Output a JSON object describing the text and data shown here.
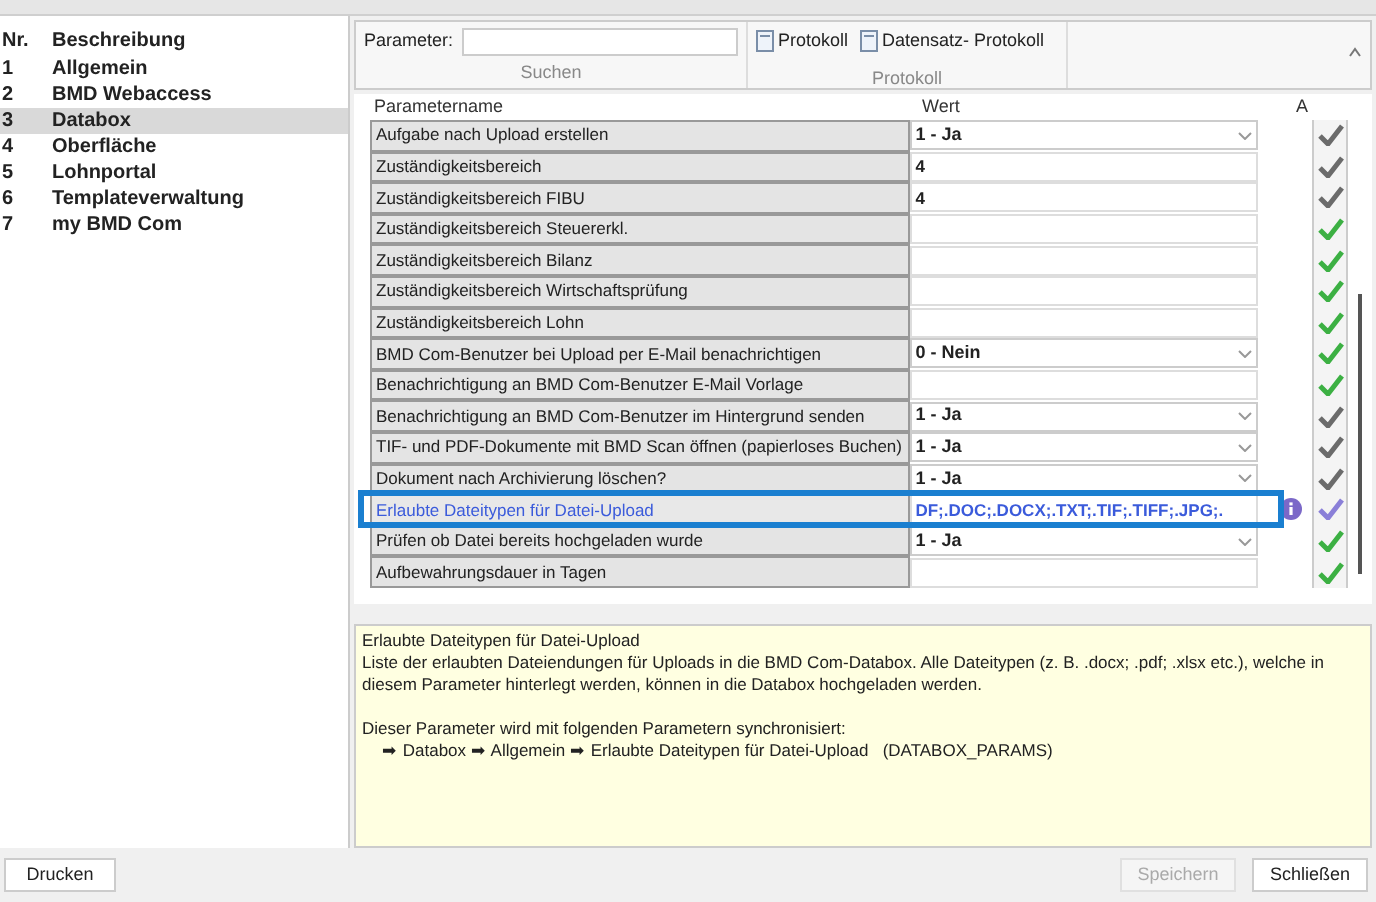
{
  "sidebar": {
    "columns": [
      "Nr.",
      "Beschreibung"
    ],
    "items": [
      {
        "nr": "1",
        "label": "Allgemein",
        "selected": false
      },
      {
        "nr": "2",
        "label": "BMD Webaccess",
        "selected": false
      },
      {
        "nr": "3",
        "label": "Databox",
        "selected": true
      },
      {
        "nr": "4",
        "label": "Oberfläche",
        "selected": false
      },
      {
        "nr": "5",
        "label": "Lohnportal",
        "selected": false
      },
      {
        "nr": "6",
        "label": "Templateverwaltung",
        "selected": false
      },
      {
        "nr": "7",
        "label": "my BMD Com",
        "selected": false
      }
    ]
  },
  "toolbar": {
    "search_label": "Parameter:",
    "search_group": "Suchen",
    "buttons": [
      "Protokoll",
      "Datensatz- Protokoll"
    ],
    "protocol_group": "Protokoll"
  },
  "table": {
    "columns": [
      "Parametername",
      "Wert",
      "A"
    ],
    "rows": [
      {
        "name": "Aufgabe nach Upload erstellen",
        "value": "1 - Ja",
        "kind": "dropdown",
        "selected": false,
        "info": false,
        "color": "#6b6b6b"
      },
      {
        "name": "Zuständigkeitsbereich",
        "value": "4",
        "kind": "text",
        "selected": false,
        "info": false,
        "color": "#6b6b6b"
      },
      {
        "name": "Zuständigkeitsbereich FIBU",
        "value": "4",
        "kind": "text",
        "selected": false,
        "info": false,
        "color": "#6b6b6b"
      },
      {
        "name": "Zuständigkeitsbereich Steuererkl.",
        "kind": "text",
        "selected": false,
        "info": false,
        "color": "#3cb043"
      },
      {
        "name": "Zuständigkeitsbereich Bilanz",
        "kind": "text",
        "selected": false,
        "info": false,
        "color": "#3cb043"
      },
      {
        "name": "Zuständigkeitsbereich Wirtschaftsprüfung",
        "kind": "text",
        "selected": false,
        "info": false,
        "color": "#3cb043"
      },
      {
        "name": "Zuständigkeitsbereich Lohn",
        "kind": "text",
        "selected": false,
        "info": false,
        "color": "#3cb043"
      },
      {
        "name": "BMD Com-Benutzer bei Upload per E-Mail benachrichtigen",
        "value": "0 - Nein",
        "kind": "dropdown",
        "selected": false,
        "info": false,
        "color": "#3cb043"
      },
      {
        "name": "Benachrichtigung an BMD Com-Benutzer E-Mail Vorlage",
        "kind": "text",
        "selected": false,
        "info": false,
        "color": "#3cb043"
      },
      {
        "name": "Benachrichtigung an BMD Com-Benutzer im Hintergrund senden",
        "value": "1 - Ja",
        "kind": "dropdown",
        "selected": false,
        "info": false,
        "color": "#6b6b6b"
      },
      {
        "name": "TIF- und PDF-Dokumente mit BMD Scan öffnen (papierloses Buchen)",
        "value": "1 - Ja",
        "kind": "dropdown",
        "selected": false,
        "info": false,
        "color": "#6b6b6b"
      },
      {
        "name": "Dokument nach Archivierung löschen?",
        "value": "1 - Ja",
        "kind": "dropdown",
        "selected": false,
        "info": false,
        "color": "#6b6b6b"
      },
      {
        "name": "Erlaubte Dateitypen für Datei-Upload",
        "value": "DF;.DOC;.DOCX;.TXT;.TIF;.TIFF;.JPG;.",
        "kind": "text",
        "selected": true,
        "info": true,
        "color": "#8a7fd8"
      },
      {
        "name": "Prüfen ob Datei bereits hochgeladen wurde",
        "value": "1 - Ja",
        "kind": "dropdown",
        "selected": false,
        "info": false,
        "color": "#3cb043"
      },
      {
        "name": "Aufbewahrungsdauer in Tagen",
        "kind": "text",
        "selected": false,
        "info": false,
        "color": "#3cb043"
      }
    ]
  },
  "description": {
    "title": "Erlaubte Dateitypen für Datei-Upload",
    "text": "Liste der erlaubten Dateiendungen für Uploads in die BMD Com-Databox. Alle Dateitypen (z. B. .docx; .pdf; .xlsx etc.), welche in diesem Parameter hinterlegt werden, können in die Databox hochgeladen werden.",
    "sync_intro": "Dieser Parameter wird mit folgenden Parametern synchronisiert:",
    "sync_path": "➡ Databox ➡ Allgemein ➡ Erlaubte Dateitypen für Datei-Upload   (DATABOX_PARAMS)"
  },
  "footer": {
    "left_button": "Drucken",
    "save_button": {
      "label": "Speichern",
      "disabled": true
    },
    "close_button": "Schließen"
  }
}
